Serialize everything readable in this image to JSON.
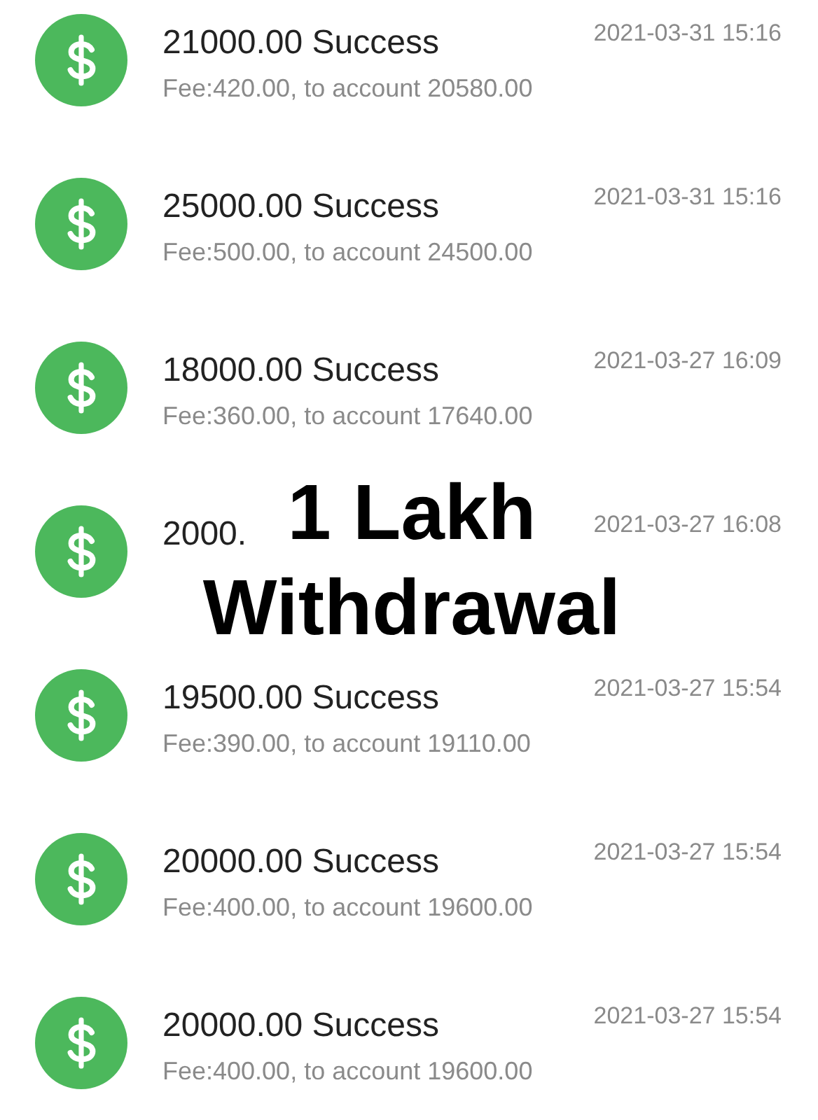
{
  "transactions": [
    {
      "amount_status": "21000.00 Success",
      "details": "Fee:420.00, to account 20580.00",
      "time": "2021-03-31 15:16"
    },
    {
      "amount_status": "25000.00 Success",
      "details": "Fee:500.00, to account 24500.00",
      "time": "2021-03-31 15:16"
    },
    {
      "amount_status": "18000.00 Success",
      "details": "Fee:360.00, to account 17640.00",
      "time": "2021-03-27 16:09"
    },
    {
      "amount_status": "2000.",
      "time": "2021-03-27 16:08"
    },
    {
      "amount_status": "19500.00 Success",
      "details": "Fee:390.00, to account 19110.00",
      "time": "2021-03-27 15:54"
    },
    {
      "amount_status": "20000.00 Success",
      "details": "Fee:400.00, to account 19600.00",
      "time": "2021-03-27 15:54"
    },
    {
      "amount_status": "20000.00 Success",
      "details": "Fee:400.00, to account 19600.00",
      "time": "2021-03-27 15:54"
    }
  ],
  "overlay": {
    "lines": [
      "1 Lakh",
      "Withdrawal"
    ]
  }
}
